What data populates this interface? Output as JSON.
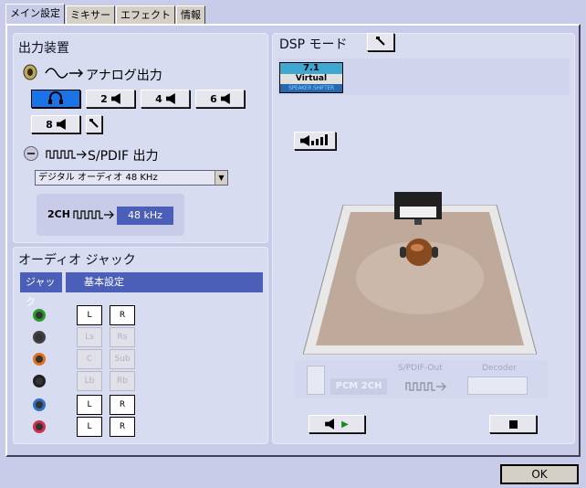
{
  "tabs": [
    {
      "label": "メイン設定"
    },
    {
      "label": "ミキサー"
    },
    {
      "label": "エフェクト"
    },
    {
      "label": "情報"
    }
  ],
  "output": {
    "title": "出力装置",
    "analog_label": "アナログ出力",
    "speaker_buttons": [
      "2",
      "4",
      "6",
      "8"
    ],
    "spdif_label": "S/PDIF 出力",
    "spdif_dropdown": "デジタル オーディオ 48 KHz",
    "spdif_channels": "2CH",
    "spdif_rate": "48 kHz"
  },
  "jack": {
    "title": "オーディオ ジャック",
    "col1": "ジャック",
    "col2": "基本設定",
    "rows": [
      {
        "color": "#2a9a2a",
        "left": "L",
        "right": "R",
        "active": true
      },
      {
        "color": "#404040",
        "left": "Ls",
        "right": "Rs",
        "active": false
      },
      {
        "color": "#e07020",
        "left": "C",
        "right": "Sub",
        "active": false
      },
      {
        "color": "#202020",
        "left": "Lb",
        "right": "Rb",
        "active": false
      },
      {
        "color": "#3070c0",
        "left": "L",
        "right": "R",
        "active": true
      },
      {
        "color": "#d03050",
        "left": "L",
        "right": "R",
        "active": true
      }
    ]
  },
  "dsp": {
    "title": "DSP モード",
    "badge_top": "7.1",
    "badge_mid": "Virtual",
    "badge_bot": "SPEAKER SHIFTER",
    "pcm": "PCM 2CH",
    "spdif_out": "S/PDIF-Out",
    "decoder": "Decoder"
  },
  "ok_label": "OK",
  "colors": {
    "accent": "#1b73e8",
    "header": "#4c5fb8",
    "bg": "#c8cce8"
  }
}
